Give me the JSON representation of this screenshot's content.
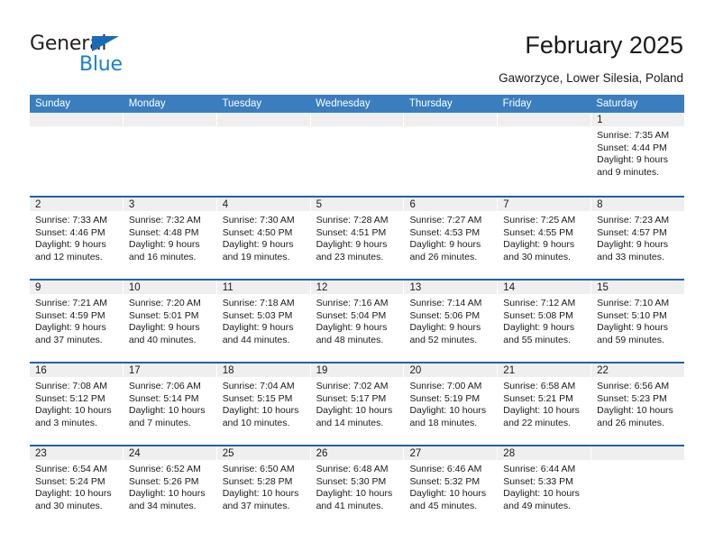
{
  "brand": {
    "name_part1": "General",
    "name_part2": "Blue",
    "triangle_color": "#1a6bb5",
    "blue_color": "#1a7fd4"
  },
  "header": {
    "title": "February 2025",
    "subtitle": "Gaworzyce, Lower Silesia, Poland"
  },
  "theme": {
    "header_blue": "#3a7ebf",
    "separator_blue": "#1f63a8",
    "daynum_gray": "#efefef"
  },
  "calendar": {
    "weekday_headers": [
      "Sunday",
      "Monday",
      "Tuesday",
      "Wednesday",
      "Thursday",
      "Friday",
      "Saturday"
    ],
    "labels": {
      "sunrise": "Sunrise:",
      "sunset": "Sunset:",
      "daylight": "Daylight:"
    },
    "weeks": [
      [
        {
          "day": "",
          "empty": true
        },
        {
          "day": "",
          "empty": true
        },
        {
          "day": "",
          "empty": true
        },
        {
          "day": "",
          "empty": true
        },
        {
          "day": "",
          "empty": true
        },
        {
          "day": "",
          "empty": true
        },
        {
          "day": "1",
          "sunrise": "Sunrise: 7:35 AM",
          "sunset": "Sunset: 4:44 PM",
          "daylight": "Daylight: 9 hours and 9 minutes."
        }
      ],
      [
        {
          "day": "2",
          "sunrise": "Sunrise: 7:33 AM",
          "sunset": "Sunset: 4:46 PM",
          "daylight": "Daylight: 9 hours and 12 minutes."
        },
        {
          "day": "3",
          "sunrise": "Sunrise: 7:32 AM",
          "sunset": "Sunset: 4:48 PM",
          "daylight": "Daylight: 9 hours and 16 minutes."
        },
        {
          "day": "4",
          "sunrise": "Sunrise: 7:30 AM",
          "sunset": "Sunset: 4:50 PM",
          "daylight": "Daylight: 9 hours and 19 minutes."
        },
        {
          "day": "5",
          "sunrise": "Sunrise: 7:28 AM",
          "sunset": "Sunset: 4:51 PM",
          "daylight": "Daylight: 9 hours and 23 minutes."
        },
        {
          "day": "6",
          "sunrise": "Sunrise: 7:27 AM",
          "sunset": "Sunset: 4:53 PM",
          "daylight": "Daylight: 9 hours and 26 minutes."
        },
        {
          "day": "7",
          "sunrise": "Sunrise: 7:25 AM",
          "sunset": "Sunset: 4:55 PM",
          "daylight": "Daylight: 9 hours and 30 minutes."
        },
        {
          "day": "8",
          "sunrise": "Sunrise: 7:23 AM",
          "sunset": "Sunset: 4:57 PM",
          "daylight": "Daylight: 9 hours and 33 minutes."
        }
      ],
      [
        {
          "day": "9",
          "sunrise": "Sunrise: 7:21 AM",
          "sunset": "Sunset: 4:59 PM",
          "daylight": "Daylight: 9 hours and 37 minutes."
        },
        {
          "day": "10",
          "sunrise": "Sunrise: 7:20 AM",
          "sunset": "Sunset: 5:01 PM",
          "daylight": "Daylight: 9 hours and 40 minutes."
        },
        {
          "day": "11",
          "sunrise": "Sunrise: 7:18 AM",
          "sunset": "Sunset: 5:03 PM",
          "daylight": "Daylight: 9 hours and 44 minutes."
        },
        {
          "day": "12",
          "sunrise": "Sunrise: 7:16 AM",
          "sunset": "Sunset: 5:04 PM",
          "daylight": "Daylight: 9 hours and 48 minutes."
        },
        {
          "day": "13",
          "sunrise": "Sunrise: 7:14 AM",
          "sunset": "Sunset: 5:06 PM",
          "daylight": "Daylight: 9 hours and 52 minutes."
        },
        {
          "day": "14",
          "sunrise": "Sunrise: 7:12 AM",
          "sunset": "Sunset: 5:08 PM",
          "daylight": "Daylight: 9 hours and 55 minutes."
        },
        {
          "day": "15",
          "sunrise": "Sunrise: 7:10 AM",
          "sunset": "Sunset: 5:10 PM",
          "daylight": "Daylight: 9 hours and 59 minutes."
        }
      ],
      [
        {
          "day": "16",
          "sunrise": "Sunrise: 7:08 AM",
          "sunset": "Sunset: 5:12 PM",
          "daylight": "Daylight: 10 hours and 3 minutes."
        },
        {
          "day": "17",
          "sunrise": "Sunrise: 7:06 AM",
          "sunset": "Sunset: 5:14 PM",
          "daylight": "Daylight: 10 hours and 7 minutes."
        },
        {
          "day": "18",
          "sunrise": "Sunrise: 7:04 AM",
          "sunset": "Sunset: 5:15 PM",
          "daylight": "Daylight: 10 hours and 10 minutes."
        },
        {
          "day": "19",
          "sunrise": "Sunrise: 7:02 AM",
          "sunset": "Sunset: 5:17 PM",
          "daylight": "Daylight: 10 hours and 14 minutes."
        },
        {
          "day": "20",
          "sunrise": "Sunrise: 7:00 AM",
          "sunset": "Sunset: 5:19 PM",
          "daylight": "Daylight: 10 hours and 18 minutes."
        },
        {
          "day": "21",
          "sunrise": "Sunrise: 6:58 AM",
          "sunset": "Sunset: 5:21 PM",
          "daylight": "Daylight: 10 hours and 22 minutes."
        },
        {
          "day": "22",
          "sunrise": "Sunrise: 6:56 AM",
          "sunset": "Sunset: 5:23 PM",
          "daylight": "Daylight: 10 hours and 26 minutes."
        }
      ],
      [
        {
          "day": "23",
          "sunrise": "Sunrise: 6:54 AM",
          "sunset": "Sunset: 5:24 PM",
          "daylight": "Daylight: 10 hours and 30 minutes."
        },
        {
          "day": "24",
          "sunrise": "Sunrise: 6:52 AM",
          "sunset": "Sunset: 5:26 PM",
          "daylight": "Daylight: 10 hours and 34 minutes."
        },
        {
          "day": "25",
          "sunrise": "Sunrise: 6:50 AM",
          "sunset": "Sunset: 5:28 PM",
          "daylight": "Daylight: 10 hours and 37 minutes."
        },
        {
          "day": "26",
          "sunrise": "Sunrise: 6:48 AM",
          "sunset": "Sunset: 5:30 PM",
          "daylight": "Daylight: 10 hours and 41 minutes."
        },
        {
          "day": "27",
          "sunrise": "Sunrise: 6:46 AM",
          "sunset": "Sunset: 5:32 PM",
          "daylight": "Daylight: 10 hours and 45 minutes."
        },
        {
          "day": "28",
          "sunrise": "Sunrise: 6:44 AM",
          "sunset": "Sunset: 5:33 PM",
          "daylight": "Daylight: 10 hours and 49 minutes."
        },
        {
          "day": "",
          "empty": true
        }
      ]
    ]
  }
}
